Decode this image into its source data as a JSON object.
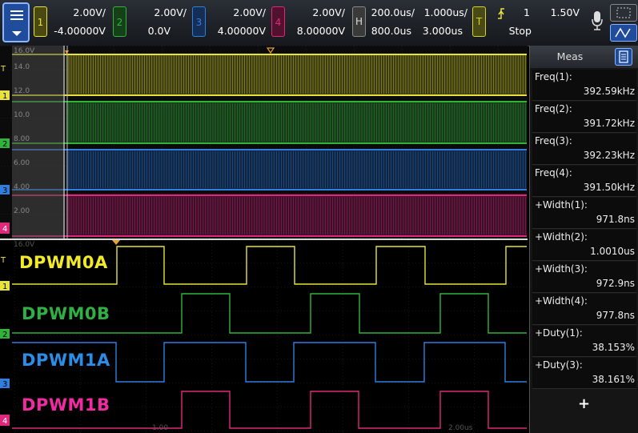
{
  "colors": {
    "ch1": "#e8e33a",
    "ch2": "#31b43a",
    "ch3": "#2f7fe0",
    "ch4": "#e0287a"
  },
  "menu_icon": "menu-icon",
  "channels": [
    {
      "num": "1",
      "scale": "2.00V/",
      "offset": "-4.00000V"
    },
    {
      "num": "2",
      "scale": "2.00V/",
      "offset": "0.0V"
    },
    {
      "num": "3",
      "scale": "2.00V/",
      "offset": "4.00000V"
    },
    {
      "num": "4",
      "scale": "2.00V/",
      "offset": "8.00000V"
    }
  ],
  "horizontal": {
    "label": "H",
    "scale": "200.0us/",
    "position": "800.0us",
    "zoom_scale": "1.000us/",
    "zoom_position": "3.000us"
  },
  "trigger": {
    "label": "T",
    "channel": "1",
    "level": "1.50V",
    "mode": "Stop"
  },
  "upper_axis": [
    "16.0V",
    "14.0",
    "12.0",
    "10.0",
    "8.00",
    "6.00",
    "4.00",
    "2.00"
  ],
  "lower_axis": [
    "16.0V"
  ],
  "lower_time_ticks": [
    "1.00",
    "2.00us"
  ],
  "trace_labels": [
    "DPWM0A",
    "DPWM0B",
    "DPWM1A",
    "DPWM1B"
  ],
  "panel": {
    "title": "Meas",
    "measurements": [
      {
        "label": "Freq(1):",
        "value": "392.59kHz"
      },
      {
        "label": "Freq(2):",
        "value": "391.72kHz"
      },
      {
        "label": "Freq(3):",
        "value": "392.23kHz"
      },
      {
        "label": "Freq(4):",
        "value": "391.50kHz"
      },
      {
        "label": "+Width(1):",
        "value": "971.8ns"
      },
      {
        "label": "+Width(2):",
        "value": "1.0010us"
      },
      {
        "label": "+Width(3):",
        "value": "972.9ns"
      },
      {
        "label": "+Width(4):",
        "value": "977.8ns"
      },
      {
        "label": "+Duty(1):",
        "value": "38.153%"
      },
      {
        "label": "+Duty(3):",
        "value": "38.161%"
      }
    ],
    "add_label": "+"
  }
}
